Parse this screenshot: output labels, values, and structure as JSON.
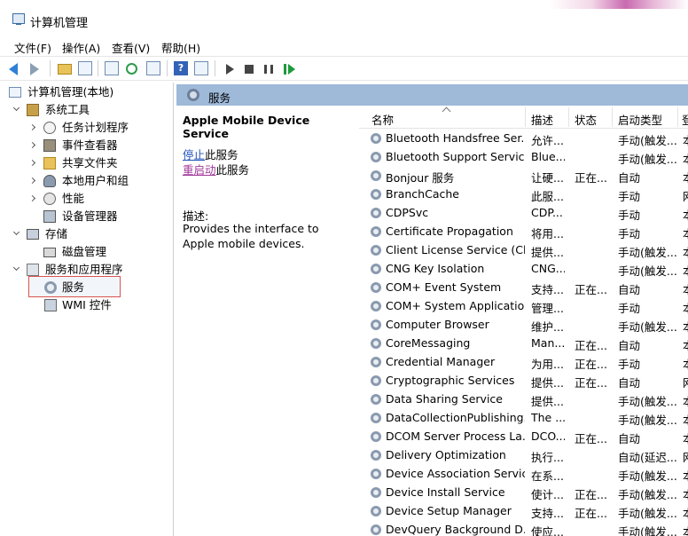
{
  "window": {
    "title": "计算机管理"
  },
  "menu": [
    "文件(F)",
    "操作(A)",
    "查看(V)",
    "帮助(H)"
  ],
  "toolbar": {
    "icons": [
      "back-arrow-icon",
      "forward-arrow-icon",
      "up-folder-icon",
      "show-tree-icon",
      "properties-icon",
      "refresh-icon",
      "export-icon",
      "help-icon",
      "panel-icon",
      "start-icon",
      "stop-icon",
      "pause-icon",
      "resume-icon"
    ],
    "help_glyph": "?"
  },
  "tree": {
    "root": "计算机管理(本地)",
    "items": [
      {
        "label": "系统工具"
      },
      {
        "label": "任务计划程序"
      },
      {
        "label": "事件查看器"
      },
      {
        "label": "共享文件夹"
      },
      {
        "label": "本地用户和组"
      },
      {
        "label": "性能"
      },
      {
        "label": "设备管理器"
      },
      {
        "label": "存储"
      },
      {
        "label": "磁盘管理"
      },
      {
        "label": "服务和应用程序"
      },
      {
        "label": "服务"
      },
      {
        "label": "WMI 控件"
      }
    ]
  },
  "pane": {
    "header": "服务",
    "service_name": "Apple Mobile Device Service",
    "action_stop_link": "停止",
    "action_stop_rest": "此服务",
    "action_restart_link": "重启动",
    "action_restart_rest": "此服务",
    "desc_label": "描述:",
    "description": "Provides the interface to Apple mobile devices."
  },
  "columns": [
    "名称",
    "描述",
    "状态",
    "启动类型",
    "登"
  ],
  "services": [
    {
      "name": "Bluetooth Handsfree Ser...",
      "desc": "允许...",
      "status": "",
      "startup": "手动(触发...",
      "logon": "本"
    },
    {
      "name": "Bluetooth Support Service",
      "desc": "Blue...",
      "status": "",
      "startup": "手动(触发...",
      "logon": "本"
    },
    {
      "name": "Bonjour 服务",
      "desc": "让硬...",
      "status": "正在...",
      "startup": "自动",
      "logon": "本"
    },
    {
      "name": "BranchCache",
      "desc": "此服...",
      "status": "",
      "startup": "手动",
      "logon": "网"
    },
    {
      "name": "CDPSvc",
      "desc": "CDP...",
      "status": "",
      "startup": "手动",
      "logon": "本"
    },
    {
      "name": "Certificate Propagation",
      "desc": "将用...",
      "status": "",
      "startup": "手动",
      "logon": "本"
    },
    {
      "name": "Client License Service (Cli...",
      "desc": "提供...",
      "status": "",
      "startup": "手动(触发...",
      "logon": "本"
    },
    {
      "name": "CNG Key Isolation",
      "desc": "CNG...",
      "status": "",
      "startup": "手动(触发...",
      "logon": "本"
    },
    {
      "name": "COM+ Event System",
      "desc": "支持...",
      "status": "正在...",
      "startup": "自动",
      "logon": "本"
    },
    {
      "name": "COM+ System Application",
      "desc": "管理...",
      "status": "",
      "startup": "手动",
      "logon": "本"
    },
    {
      "name": "Computer Browser",
      "desc": "维护...",
      "status": "",
      "startup": "手动(触发...",
      "logon": "本"
    },
    {
      "name": "CoreMessaging",
      "desc": "Man...",
      "status": "正在...",
      "startup": "自动",
      "logon": "本"
    },
    {
      "name": "Credential Manager",
      "desc": "为用...",
      "status": "正在...",
      "startup": "手动",
      "logon": "本"
    },
    {
      "name": "Cryptographic Services",
      "desc": "提供...",
      "status": "正在...",
      "startup": "自动",
      "logon": "网"
    },
    {
      "name": "Data Sharing Service",
      "desc": "提供...",
      "status": "",
      "startup": "手动(触发...",
      "logon": "本"
    },
    {
      "name": "DataCollectionPublishing...",
      "desc": "The ...",
      "status": "",
      "startup": "手动(触发...",
      "logon": "本"
    },
    {
      "name": "DCOM Server Process La...",
      "desc": "DCO...",
      "status": "正在...",
      "startup": "自动",
      "logon": "本"
    },
    {
      "name": "Delivery Optimization",
      "desc": "执行...",
      "status": "",
      "startup": "自动(延迟...",
      "logon": "网"
    },
    {
      "name": "Device Association Service",
      "desc": "在系...",
      "status": "",
      "startup": "手动(触发...",
      "logon": "本"
    },
    {
      "name": "Device Install Service",
      "desc": "使计...",
      "status": "正在...",
      "startup": "手动(触发...",
      "logon": "本"
    },
    {
      "name": "Device Setup Manager",
      "desc": "支持...",
      "status": "正在...",
      "startup": "手动(触发...",
      "logon": "本"
    },
    {
      "name": "DevQuery Background D...",
      "desc": "使应...",
      "status": "",
      "startup": "手动(触发...",
      "logon": "本"
    }
  ],
  "colors": {
    "header_band": "#9fb9d9",
    "link": "#1c4fb7",
    "link_visited": "#a0379a",
    "selection_outline": "#d9534f"
  }
}
